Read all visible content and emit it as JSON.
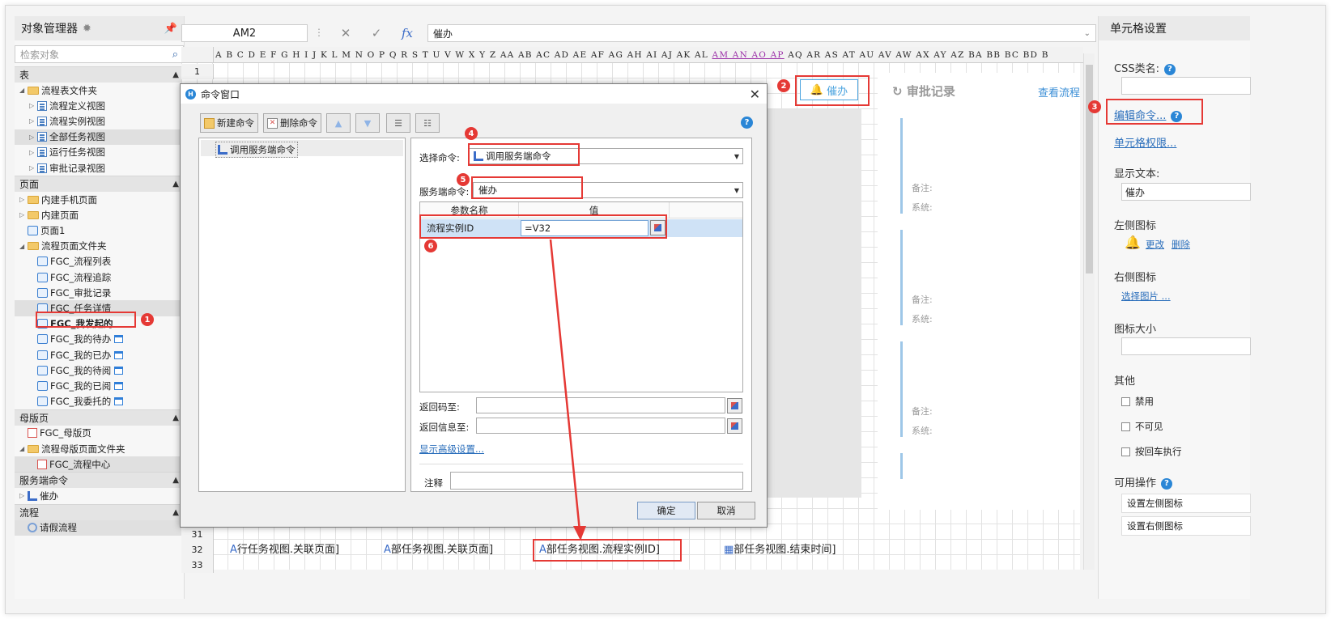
{
  "left_panel": {
    "title": "对象管理器",
    "search_placeholder": "检索对象",
    "sections": {
      "tables": "表",
      "pages": "页面",
      "master": "母版页",
      "server_cmd": "服务端命令",
      "flow": "流程"
    },
    "table_items": {
      "folder": "流程表文件夹",
      "items": [
        "流程定义视图",
        "流程实例视图",
        "全部任务视图",
        "运行任务视图",
        "审批记录视图"
      ]
    },
    "page_items": {
      "mobile": "内建手机页面",
      "builtin": "内建页面",
      "page1": "页面1",
      "folder": "流程页面文件夹",
      "items": [
        "FGC_流程列表",
        "FGC_流程追踪",
        "FGC_审批记录",
        "FGC_任务详情",
        "FGC_我发起的",
        "FGC_我的待办",
        "FGC_我的已办",
        "FGC_我的待阅",
        "FGC_我的已阅",
        "FGC_我委托的"
      ]
    },
    "master_items": {
      "master": "FGC_母版页",
      "folder": "流程母版页面文件夹",
      "center": "FGC_流程中心"
    },
    "server_items": [
      "催办"
    ],
    "flow_items": [
      "请假流程"
    ]
  },
  "formula_bar": {
    "cell_ref": "AM2",
    "formula": "催办",
    "fx": "fx"
  },
  "sheet": {
    "columns_a": "A B C D E F G H I J K L M N O P Q R S T U V W X Y Z AA AB AC AD AE AF AG AH AI AJ AK AL",
    "columns_hl": "AM AN AO AP",
    "columns_b": "AQ AR AS AT AU AV AW AX AY AZ BA BB BC BD B",
    "row_numbers": [
      "1",
      "31",
      "32",
      "33"
    ],
    "urge_button": "催办",
    "approval_title": "审批记录",
    "approval_link": "查看流程",
    "note_label": "备注:",
    "system_label": "系统:",
    "row32_cells": [
      "行任务视图.关联页面]",
      "部任务视图.关联页面]",
      "部任务视图.流程实例ID]",
      "部任务视图.结束时间]"
    ]
  },
  "dialog": {
    "title": "命令窗口",
    "toolbar": {
      "new_cmd": "新建命令",
      "delete_cmd": "删除命令"
    },
    "tree_item": "调用服务端命令",
    "select_cmd_label": "选择命令:",
    "select_cmd_value": "调用服务端命令",
    "server_cmd_label": "服务端命令:",
    "server_cmd_value": "催办",
    "param_header_name": "参数名称",
    "param_header_value": "值",
    "param_name": "流程实例ID",
    "param_value": "=V32",
    "return_code_label": "返回码至:",
    "return_msg_label": "返回信息至:",
    "advanced_link": "显示高级设置...",
    "comment_label": "注释",
    "ok": "确定",
    "cancel": "取消"
  },
  "right_panel": {
    "title": "单元格设置",
    "css_label": "CSS类名:",
    "edit_cmd": "编辑命令...",
    "cell_perm": "单元格权限...",
    "display_text_label": "显示文本:",
    "display_text_value": "催办",
    "left_icon_label": "左侧图标",
    "change": "更改",
    "delete": "删除",
    "right_icon_label": "右侧图标",
    "select_image": "选择图片 ...",
    "icon_size_label": "图标大小",
    "other_label": "其他",
    "disabled": "禁用",
    "invisible": "不可见",
    "enter_exec": "按回车执行",
    "ops_label": "可用操作",
    "ops": [
      "设置左侧图标",
      "设置右侧图标"
    ]
  },
  "badges": [
    "1",
    "2",
    "3",
    "4",
    "5",
    "6"
  ]
}
